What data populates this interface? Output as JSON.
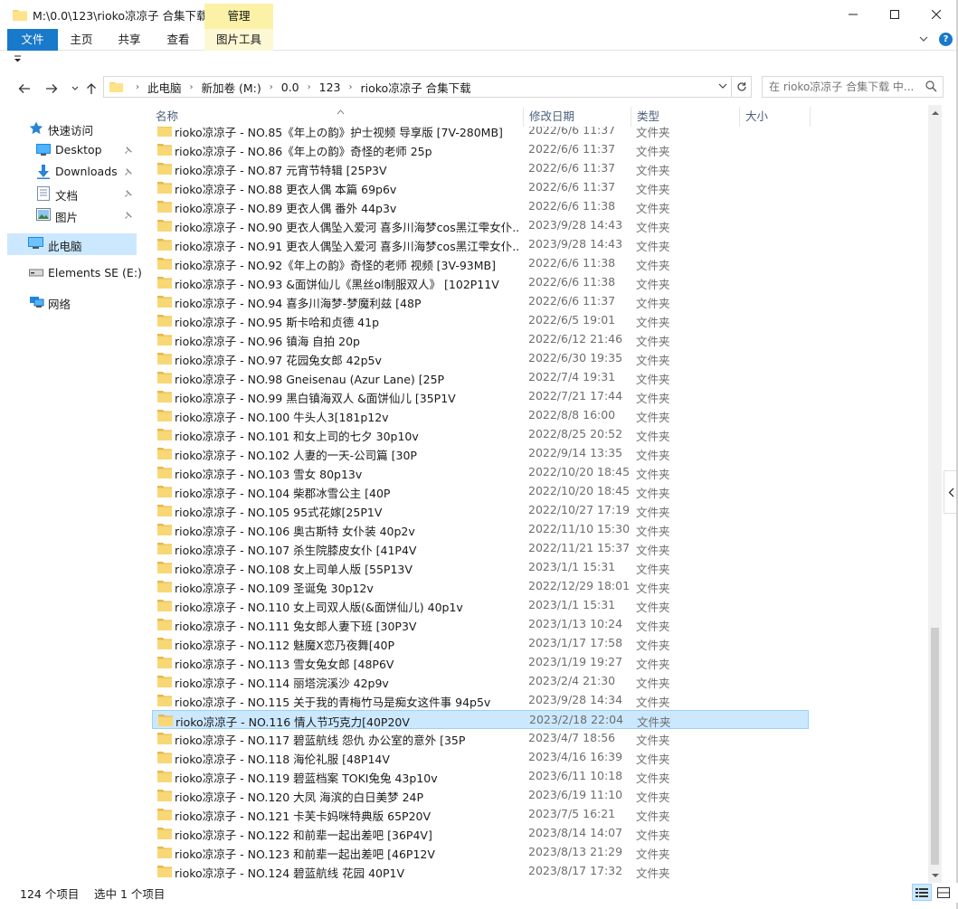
{
  "window": {
    "title": "M:\\0.0\\123\\rioko凉凉子 合集下载",
    "context_tab_group": "管理"
  },
  "ribbon": {
    "tabs": [
      "文件",
      "主页",
      "共享",
      "查看",
      "图片工具"
    ],
    "help": "?"
  },
  "address": {
    "segments": [
      "此电脑",
      "新加卷 (M:)",
      "0.0",
      "123",
      "rioko凉凉子 合集下载"
    ]
  },
  "search": {
    "placeholder": "在 rioko凉凉子 合集下载 中..."
  },
  "nav": {
    "quick_access": "快速访问",
    "desktop": "Desktop",
    "downloads": "Downloads",
    "documents": "文档",
    "pictures": "图片",
    "this_pc": "此电脑",
    "elements": "Elements SE (E:)",
    "network": "网络"
  },
  "columns": {
    "name": "名称",
    "date": "修改日期",
    "type": "类型",
    "size": "大小"
  },
  "files": [
    {
      "name": "rioko凉凉子 - NO.85《年上の韵》护士视频 导享版 [7V-280MB]",
      "date": "2022/6/6 11:37",
      "type": "文件夹"
    },
    {
      "name": "rioko凉凉子 - NO.86《年上の韵》奇怪的老师 25p",
      "date": "2022/6/6 11:37",
      "type": "文件夹"
    },
    {
      "name": "rioko凉凉子 - NO.87 元宵节特辑 [25P3V",
      "date": "2022/6/6 11:37",
      "type": "文件夹"
    },
    {
      "name": "rioko凉凉子 - NO.88 更衣人偶 本篇 69p6v",
      "date": "2022/6/6 11:37",
      "type": "文件夹"
    },
    {
      "name": "rioko凉凉子 - NO.89 更衣人偶 番外 44p3v",
      "date": "2022/6/6 11:38",
      "type": "文件夹"
    },
    {
      "name": "rioko凉凉子 - NO.90 更衣人偶坠入爱河 喜多川海梦cos黑江雫女仆...",
      "date": "2023/9/28 14:43",
      "type": "文件夹"
    },
    {
      "name": "rioko凉凉子 - NO.91 更衣人偶坠入爱河 喜多川海梦cos黑江雫女仆...",
      "date": "2023/9/28 14:43",
      "type": "文件夹"
    },
    {
      "name": "rioko凉凉子 - NO.92《年上の韵》奇怪的老师 视频 [3V-93MB]",
      "date": "2022/6/6 11:38",
      "type": "文件夹"
    },
    {
      "name": "rioko凉凉子 - NO.93 &面饼仙儿《黑丝ol制服双人》 [102P11V",
      "date": "2022/6/6 11:38",
      "type": "文件夹"
    },
    {
      "name": "rioko凉凉子 - NO.94 喜多川海梦-梦魔利兹 [48P",
      "date": "2022/6/6 11:37",
      "type": "文件夹"
    },
    {
      "name": "rioko凉凉子 - NO.95 斯卡哈和贞德 41p",
      "date": "2022/6/5 19:01",
      "type": "文件夹"
    },
    {
      "name": "rioko凉凉子 - NO.96 镇海 自拍 20p",
      "date": "2022/6/12 21:46",
      "type": "文件夹"
    },
    {
      "name": "rioko凉凉子 - NO.97 花园兔女郎 42p5v",
      "date": "2022/6/30 19:35",
      "type": "文件夹"
    },
    {
      "name": "rioko凉凉子 - NO.98 Gneisenau (Azur Lane) [25P",
      "date": "2022/7/4 19:31",
      "type": "文件夹"
    },
    {
      "name": "rioko凉凉子 - NO.99 黑白镇海双人 &面饼仙儿 [35P1V",
      "date": "2022/7/21 17:44",
      "type": "文件夹"
    },
    {
      "name": "rioko凉凉子 - NO.100 牛头人3[181p12v",
      "date": "2022/8/8 16:00",
      "type": "文件夹"
    },
    {
      "name": "rioko凉凉子 - NO.101 和女上司的七夕 30p10v",
      "date": "2022/8/25 20:52",
      "type": "文件夹"
    },
    {
      "name": "rioko凉凉子 - NO.102 人妻的一天-公司篇 [30P",
      "date": "2022/9/14 13:35",
      "type": "文件夹"
    },
    {
      "name": "rioko凉凉子 - NO.103 雪女 80p13v",
      "date": "2022/10/20 18:45",
      "type": "文件夹"
    },
    {
      "name": "rioko凉凉子 - NO.104 柴郡冰雪公主 [40P",
      "date": "2022/10/20 18:45",
      "type": "文件夹"
    },
    {
      "name": "rioko凉凉子 - NO.105 95式花嫁[25P1V",
      "date": "2022/10/27 17:19",
      "type": "文件夹"
    },
    {
      "name": "rioko凉凉子 - NO.106 奥古斯特 女仆装 40p2v",
      "date": "2022/11/10 15:30",
      "type": "文件夹"
    },
    {
      "name": "rioko凉凉子 - NO.107 杀生院膝皮女仆 [41P4V",
      "date": "2022/11/21 15:37",
      "type": "文件夹"
    },
    {
      "name": "rioko凉凉子 - NO.108 女上司单人版 [55P13V",
      "date": "2023/1/1 15:31",
      "type": "文件夹"
    },
    {
      "name": "rioko凉凉子 - NO.109 圣诞兔 30p12v",
      "date": "2022/12/29 18:01",
      "type": "文件夹"
    },
    {
      "name": "rioko凉凉子 - NO.110 女上司双人版(&面饼仙儿) 40p1v",
      "date": "2023/1/1 15:31",
      "type": "文件夹"
    },
    {
      "name": "rioko凉凉子 - NO.111 兔女郎人妻下班 [30P3V",
      "date": "2023/1/13 10:24",
      "type": "文件夹"
    },
    {
      "name": "rioko凉凉子 - NO.112 魅魔X恋乃夜舞[40P",
      "date": "2023/1/17 17:58",
      "type": "文件夹"
    },
    {
      "name": "rioko凉凉子 - NO.113 雪女兔女郎 [48P6V",
      "date": "2023/1/19 19:27",
      "type": "文件夹"
    },
    {
      "name": "rioko凉凉子 - NO.114 丽塔浣溪沙 42p9v",
      "date": "2023/2/4 21:30",
      "type": "文件夹"
    },
    {
      "name": "rioko凉凉子 - NO.115 关于我的青梅竹马是痴女这件事 94p5v",
      "date": "2023/9/28 14:34",
      "type": "文件夹"
    },
    {
      "name": "rioko凉凉子 - NO.116 情人节巧克力[40P20V",
      "date": "2023/2/18 22:04",
      "type": "文件夹"
    },
    {
      "name": "rioko凉凉子 - NO.117 碧蓝航线 怨仇 办公室的意外 [35P",
      "date": "2023/4/7 18:56",
      "type": "文件夹"
    },
    {
      "name": "rioko凉凉子 - NO.118 海伦礼服 [48P14V",
      "date": "2023/4/16 16:39",
      "type": "文件夹"
    },
    {
      "name": "rioko凉凉子 - NO.119 碧蓝档案 TOKI兔兔 43p10v",
      "date": "2023/6/11 10:18",
      "type": "文件夹"
    },
    {
      "name": "rioko凉凉子 - NO.120 大凤 海滨的白日美梦 24P",
      "date": "2023/6/19 11:10",
      "type": "文件夹"
    },
    {
      "name": "rioko凉凉子 - NO.121 卡芙卡妈咪特典版 65P20V",
      "date": "2023/7/5 16:21",
      "type": "文件夹"
    },
    {
      "name": "rioko凉凉子 - NO.122 和前辈一起出差吧 [36P4V]",
      "date": "2023/8/14 14:07",
      "type": "文件夹"
    },
    {
      "name": "rioko凉凉子 - NO.123 和前辈一起出差吧 [46P12V",
      "date": "2023/8/13 21:29",
      "type": "文件夹"
    },
    {
      "name": "rioko凉凉子 - NO.124 碧蓝航线 花园 40P1V",
      "date": "2023/8/17 17:32",
      "type": "文件夹"
    }
  ],
  "selected_index": 31,
  "status": {
    "count": "124 个项目",
    "selected": "选中 1 个项目"
  },
  "colors": {
    "accent": "#1979ca",
    "selection": "#cce8ff",
    "selection_border": "#99d1ff",
    "folder": "#f8d775",
    "context_tab": "#fbf2a8"
  }
}
